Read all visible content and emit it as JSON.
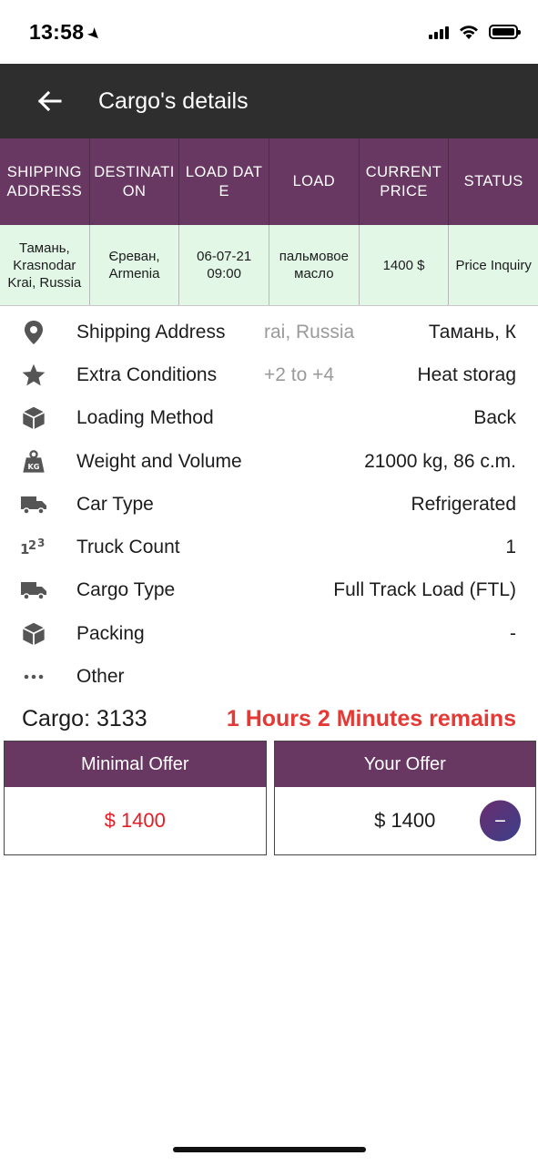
{
  "status_bar": {
    "time": "13:58",
    "location_glyph": "➤"
  },
  "app_bar": {
    "title": "Cargo's details"
  },
  "table": {
    "headers": [
      "SHIPPING ADDRESS",
      "DESTINATION",
      "LOAD DATE",
      "LOAD",
      "CURRENT PRICE",
      "STATUS"
    ],
    "row": [
      "Тамань, Krasnodar Krai, Russia",
      "Єреван, Armenia",
      "06-07-21 09:00",
      "пальмовое масло",
      "1400 $",
      "Price Inquiry"
    ]
  },
  "details": [
    {
      "icon": "location-pin-icon",
      "label": "Shipping Address",
      "value_left": "rai, Russia",
      "value_right": "Тамань, К"
    },
    {
      "icon": "star-icon",
      "label": "Extra Conditions",
      "value_left": "+2 to +4",
      "value_right": "Heat storag"
    },
    {
      "icon": "cube-icon",
      "label": "Loading Method",
      "value": "Back"
    },
    {
      "icon": "kg-weight-icon",
      "label": "Weight and Volume",
      "value": "21000 kg, 86  c.m."
    },
    {
      "icon": "truck-icon",
      "label": "Car Type",
      "value": "Refrigerated"
    },
    {
      "icon": "number-123-icon",
      "label": "Truck Count",
      "value": "1"
    },
    {
      "icon": "truck-icon",
      "label": "Cargo Type",
      "value": "Full Track Load (FTL)"
    },
    {
      "icon": "cube-icon",
      "label": "Packing",
      "value": "-"
    },
    {
      "icon": "more-dots-icon",
      "label": "Other",
      "value": ""
    }
  ],
  "cargo": {
    "label": "Cargo:",
    "number": "3133",
    "timer": "1 Hours 2 Minutes remains"
  },
  "offers": {
    "minimal_title": "Minimal Offer",
    "minimal_value": "$ 1400",
    "your_title": "Your Offer",
    "your_value": "$ 1400",
    "minus_label": "−"
  },
  "colors": {
    "accent_purple": "#683762",
    "app_bar": "#2e2e2e",
    "row_green": "#e2f7e6",
    "alert_red": "#e53935"
  }
}
